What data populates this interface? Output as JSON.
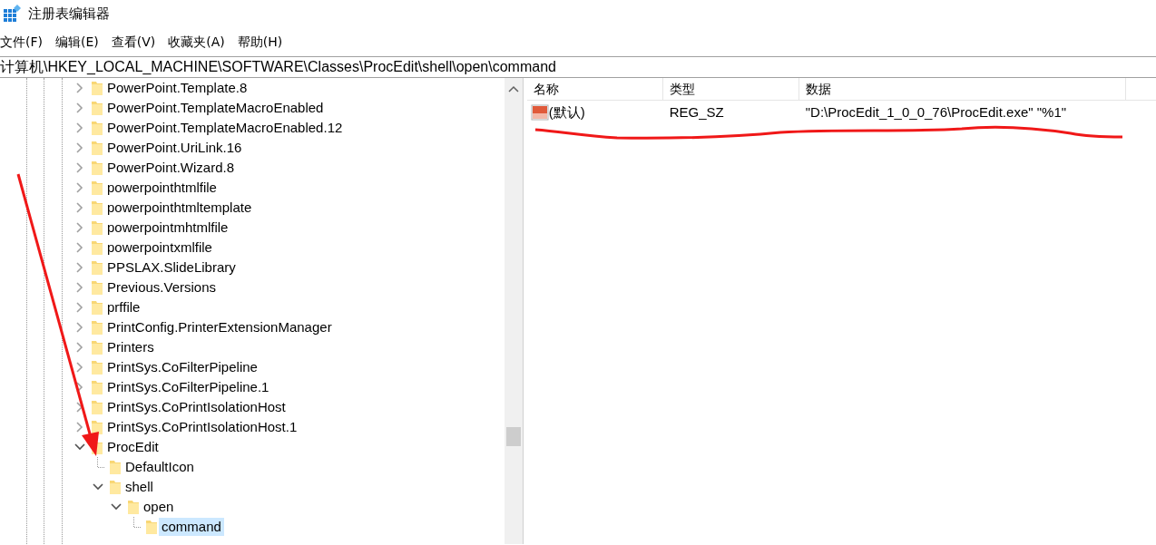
{
  "window": {
    "title": "注册表编辑器"
  },
  "menu": [
    {
      "label": "文件(F)"
    },
    {
      "label": "编辑(E)"
    },
    {
      "label": "查看(V)"
    },
    {
      "label": "收藏夹(A)"
    },
    {
      "label": "帮助(H)"
    }
  ],
  "address": "计算机\\HKEY_LOCAL_MACHINE\\SOFTWARE\\Classes\\ProcEdit\\shell\\open\\command",
  "tree": [
    {
      "label": "PowerPoint.Template.8",
      "has_children": true,
      "expanded": false,
      "selected": false
    },
    {
      "label": "PowerPoint.TemplateMacroEnabled",
      "has_children": true,
      "expanded": false,
      "selected": false
    },
    {
      "label": "PowerPoint.TemplateMacroEnabled.12",
      "has_children": true,
      "expanded": false,
      "selected": false
    },
    {
      "label": "PowerPoint.UriLink.16",
      "has_children": true,
      "expanded": false,
      "selected": false
    },
    {
      "label": "PowerPoint.Wizard.8",
      "has_children": true,
      "expanded": false,
      "selected": false
    },
    {
      "label": "powerpointhtmlfile",
      "has_children": true,
      "expanded": false,
      "selected": false
    },
    {
      "label": "powerpointhtmltemplate",
      "has_children": true,
      "expanded": false,
      "selected": false
    },
    {
      "label": "powerpointmhtmlfile",
      "has_children": true,
      "expanded": false,
      "selected": false
    },
    {
      "label": "powerpointxmlfile",
      "has_children": true,
      "expanded": false,
      "selected": false
    },
    {
      "label": "PPSLAX.SlideLibrary",
      "has_children": true,
      "expanded": false,
      "selected": false
    },
    {
      "label": "Previous.Versions",
      "has_children": true,
      "expanded": false,
      "selected": false
    },
    {
      "label": "prffile",
      "has_children": true,
      "expanded": false,
      "selected": false
    },
    {
      "label": "PrintConfig.PrinterExtensionManager",
      "has_children": true,
      "expanded": false,
      "selected": false
    },
    {
      "label": "Printers",
      "has_children": true,
      "expanded": false,
      "selected": false
    },
    {
      "label": "PrintSys.CoFilterPipeline",
      "has_children": true,
      "expanded": false,
      "selected": false
    },
    {
      "label": "PrintSys.CoFilterPipeline.1",
      "has_children": true,
      "expanded": false,
      "selected": false
    },
    {
      "label": "PrintSys.CoPrintIsolationHost",
      "has_children": true,
      "expanded": false,
      "selected": false
    },
    {
      "label": "PrintSys.CoPrintIsolationHost.1",
      "has_children": true,
      "expanded": false,
      "selected": false
    },
    {
      "label": "ProcEdit",
      "has_children": true,
      "expanded": true,
      "selected": false,
      "children": [
        {
          "label": "DefaultIcon",
          "has_children": false,
          "expanded": false,
          "selected": false
        },
        {
          "label": "shell",
          "has_children": true,
          "expanded": true,
          "selected": false,
          "children": [
            {
              "label": "open",
              "has_children": true,
              "expanded": true,
              "selected": false,
              "children": [
                {
                  "label": "command",
                  "has_children": false,
                  "expanded": false,
                  "selected": true
                }
              ]
            }
          ]
        }
      ]
    }
  ],
  "values": {
    "columns": [
      {
        "label": "名称"
      },
      {
        "label": "类型"
      },
      {
        "label": "数据"
      }
    ],
    "rows": [
      {
        "name": "(默认)",
        "type": "REG_SZ",
        "data": "\"D:\\ProcEdit_1_0_0_76\\ProcEdit.exe\" \"%1\""
      }
    ]
  }
}
